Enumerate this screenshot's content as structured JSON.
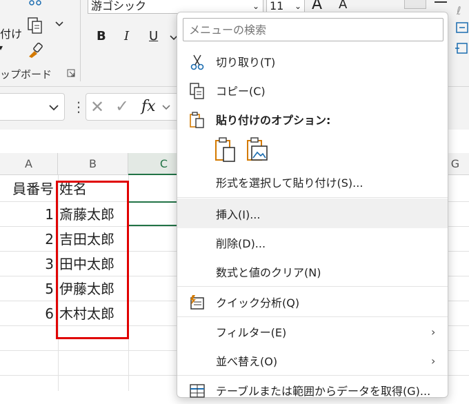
{
  "ribbon": {
    "paste_label_fragment": "付け",
    "clipboard_group_label": "ップボード",
    "font_name": "游ゴシック",
    "font_size": "11",
    "bold": "B",
    "italic": "I",
    "underline": "U",
    "grow_font": "A",
    "shrink_font": "A"
  },
  "formula_bar": {
    "cancel": "✕",
    "confirm": "✓",
    "fx": "fx",
    "dots": "⋮"
  },
  "grid": {
    "columns": [
      "A",
      "B",
      "C",
      "G"
    ],
    "a1": "員番号",
    "b1": "姓名",
    "rows": [
      {
        "num": "1",
        "name": "斎藤太郎"
      },
      {
        "num": "2",
        "name": "吉田太郎"
      },
      {
        "num": "3",
        "name": "田中太郎"
      },
      {
        "num": "5",
        "name": "伊藤太郎"
      },
      {
        "num": "6",
        "name": "木村太郎"
      }
    ]
  },
  "context_menu": {
    "search_placeholder": "メニューの検索",
    "cut": "切り取り(T)",
    "copy": "コピー(C)",
    "paste_options": "貼り付けのオプション:",
    "paste_special": "形式を選択して貼り付け(S)...",
    "insert": "挿入(I)...",
    "delete": "削除(D)...",
    "clear": "数式と値のクリア(N)",
    "quick_analysis": "クイック分析(Q)",
    "filter": "フィルター(E)",
    "sort": "並べ替え(O)",
    "get_data": "テーブルまたは範囲からデータを取得(G)..."
  },
  "colors": {
    "accent_green": "#217346",
    "highlight_red": "#e00000",
    "icon_orange": "#d47a00",
    "icon_blue": "#1a6cb0"
  }
}
